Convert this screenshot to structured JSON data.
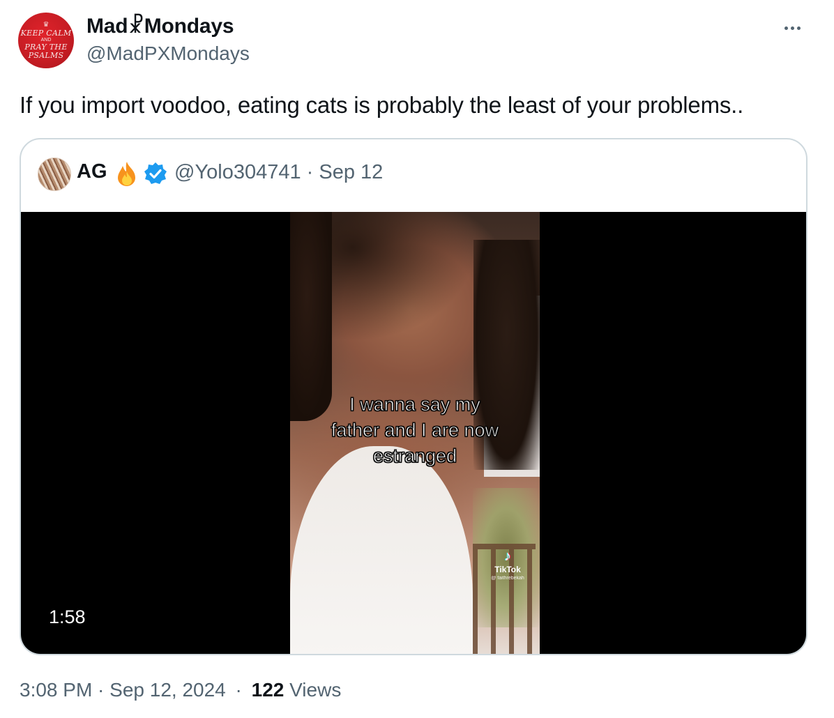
{
  "author": {
    "display_name": "Mad☧Mondays",
    "handle": "@MadPXMondays",
    "avatar_text": {
      "line1": "KEEP CALM",
      "line2": "AND",
      "line3": "PRAY THE",
      "line4": "PSALMS"
    },
    "avatar_color": "#c81d24"
  },
  "tweet": {
    "text": "If you import voodoo, eating cats is probably the least of your problems.."
  },
  "quote": {
    "name": "AG",
    "handle_date": "@Yolo304741 · Sep 12",
    "verified_color": "#1d9bf0",
    "media": {
      "caption": {
        "line1": "I wanna say my",
        "line2": "father and I are now",
        "line3": "estranged"
      },
      "watermark_label": "TikTok",
      "watermark_user": "@ faithrebekah",
      "duration": "1:58"
    }
  },
  "meta": {
    "time_date": "3:08 PM · Sep 12, 2024",
    "separator": "·",
    "views_count": "122",
    "views_label": "Views"
  }
}
